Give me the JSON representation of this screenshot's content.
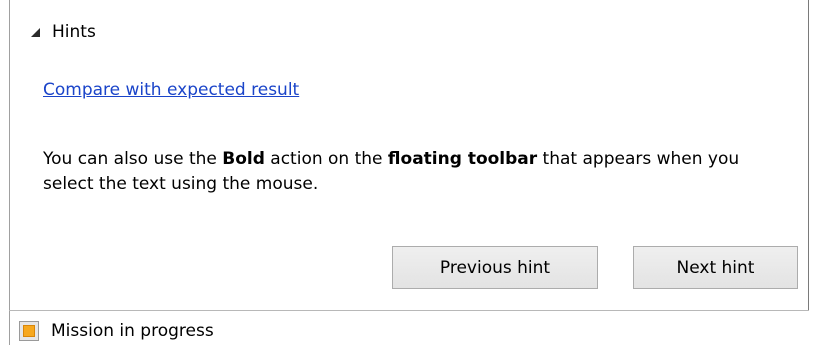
{
  "hints": {
    "title": "Hints",
    "compare_link": "Compare with expected result",
    "text": {
      "part1": "You can also use the ",
      "bold1": "Bold",
      "part2": " action on the ",
      "bold2": "floating toolbar",
      "part3": " that appears when you select the text using the mouse."
    },
    "previous_button": "Previous hint",
    "next_button": "Next hint"
  },
  "status": {
    "label": "Mission in progress",
    "color": "#f7a81e"
  },
  "icons": {
    "collapse": "triangle-collapse-icon",
    "status": "status-square-icon"
  }
}
